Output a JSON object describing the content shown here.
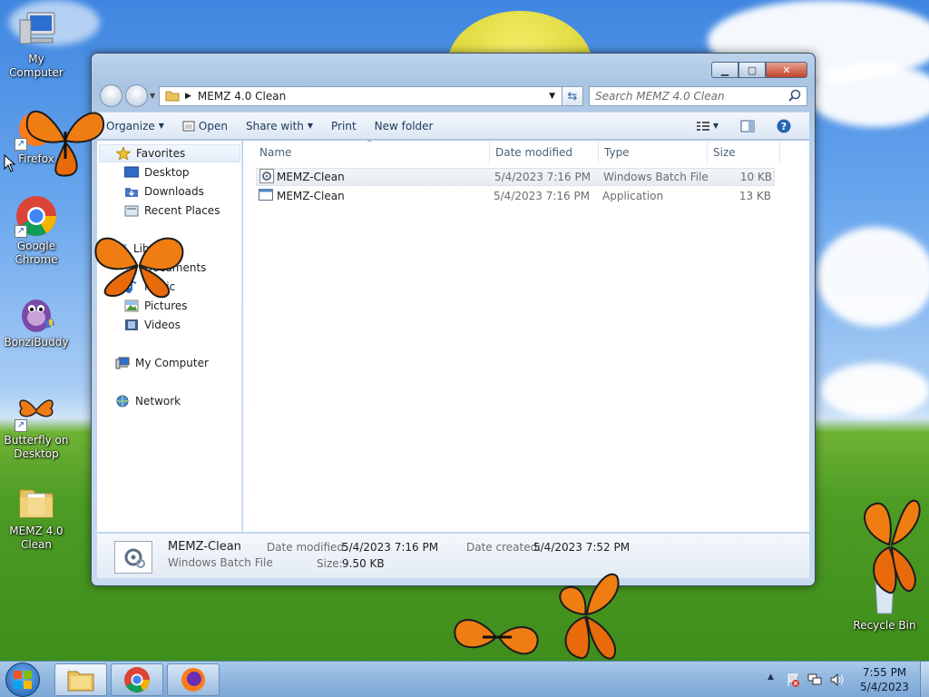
{
  "desktop": {
    "icons": [
      {
        "label": "My Computer"
      },
      {
        "label": "Firefox"
      },
      {
        "label": "Google Chrome"
      },
      {
        "label": "BonziBuddy"
      },
      {
        "label": "Butterfly on Desktop"
      },
      {
        "label": "MEMZ 4.0 Clean"
      },
      {
        "label": "Recycle Bin"
      }
    ]
  },
  "window": {
    "address": {
      "path": "MEMZ 4.0 Clean"
    },
    "search": {
      "placeholder": "Search MEMZ 4.0 Clean"
    },
    "toolbar": {
      "organize": "Organize",
      "open": "Open",
      "share_with": "Share with",
      "print": "Print",
      "new_folder": "New folder"
    },
    "nav": {
      "favorites": "Favorites",
      "desktop": "Desktop",
      "downloads": "Downloads",
      "recent": "Recent Places",
      "libraries": "Libraries",
      "documents": "Documents",
      "music": "Music",
      "pictures": "Pictures",
      "videos": "Videos",
      "computer": "My Computer",
      "network": "Network"
    },
    "columns": {
      "name": "Name",
      "date": "Date modified",
      "type": "Type",
      "size": "Size"
    },
    "files": [
      {
        "name": "MEMZ-Clean",
        "date": "5/4/2023 7:16 PM",
        "type": "Windows Batch File",
        "size": "10 KB"
      },
      {
        "name": "MEMZ-Clean",
        "date": "5/4/2023 7:16 PM",
        "type": "Application",
        "size": "13 KB"
      }
    ],
    "details": {
      "name": "MEMZ-Clean",
      "type": "Windows Batch File",
      "modified_label": "Date modified:",
      "modified": "5/4/2023 7:16 PM",
      "created_label": "Date created:",
      "created": "5/4/2023 7:52 PM",
      "size_label": "Size:",
      "size": "9.50 KB"
    }
  },
  "taskbar": {
    "time": "7:55 PM",
    "date": "5/4/2023"
  }
}
